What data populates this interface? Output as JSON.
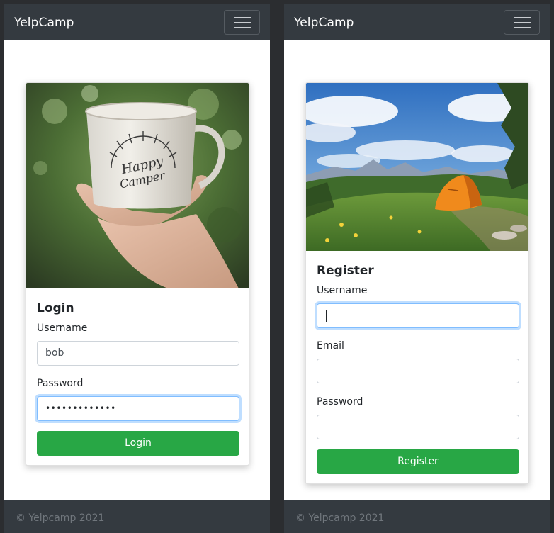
{
  "brand": "YelpCamp",
  "footer": "© Yelpcamp 2021",
  "login": {
    "title": "Login",
    "username_label": "Username",
    "username_value": "bob",
    "password_label": "Password",
    "password_value": "•••••••••••••",
    "button": "Login"
  },
  "register": {
    "title": "Register",
    "username_label": "Username",
    "email_label": "Email",
    "password_label": "Password",
    "button": "Register"
  },
  "colors": {
    "navbar": "#343a40",
    "success": "#28a745",
    "focus": "#80bdff"
  },
  "icons": [
    "hamburger-icon"
  ]
}
